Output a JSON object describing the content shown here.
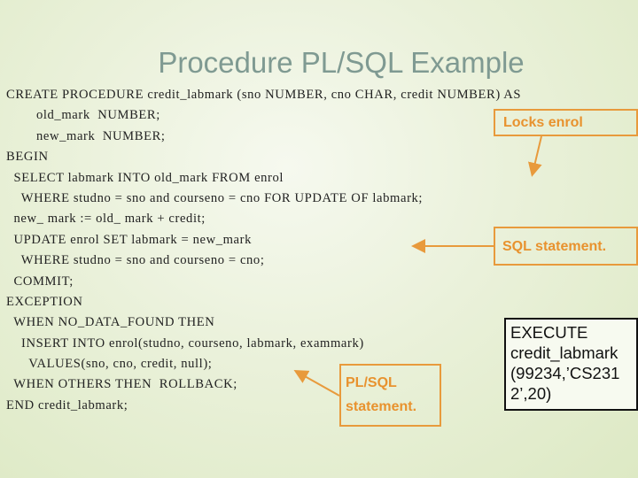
{
  "slide": {
    "title": "Procedure PL/SQL Example"
  },
  "code": {
    "lines": [
      "CREATE PROCEDURE credit_labmark (sno NUMBER, cno CHAR, credit NUMBER) AS",
      "        old_mark  NUMBER;",
      "        new_mark  NUMBER;",
      "BEGIN",
      "  SELECT labmark INTO old_mark FROM enrol",
      "    WHERE studno = sno and courseno = cno FOR UPDATE OF labmark;",
      "  new_ mark := old_ mark + credit;",
      "  UPDATE enrol SET labmark = new_mark",
      "    WHERE studno = sno and courseno = cno;",
      "  COMMIT;",
      "EXCEPTION",
      "  WHEN NO_DATA_FOUND THEN",
      "    INSERT INTO enrol(studno, courseno, labmark, exammark)",
      "      VALUES(sno, cno, credit, null);",
      "  WHEN OTHERS THEN  ROLLBACK;",
      "END credit_labmark;"
    ]
  },
  "callouts": {
    "locks": "Locks enrol",
    "sql": "SQL statement.",
    "plsql_line1": "PL/SQL",
    "plsql_line2": "statement."
  },
  "execute_box": {
    "lines": [
      "EXECUTE",
      "credit_labmark",
      "(99234,’CS231",
      "2’,20)"
    ]
  },
  "colors": {
    "callout": "#e89a3c",
    "title": "#7f9a92"
  }
}
